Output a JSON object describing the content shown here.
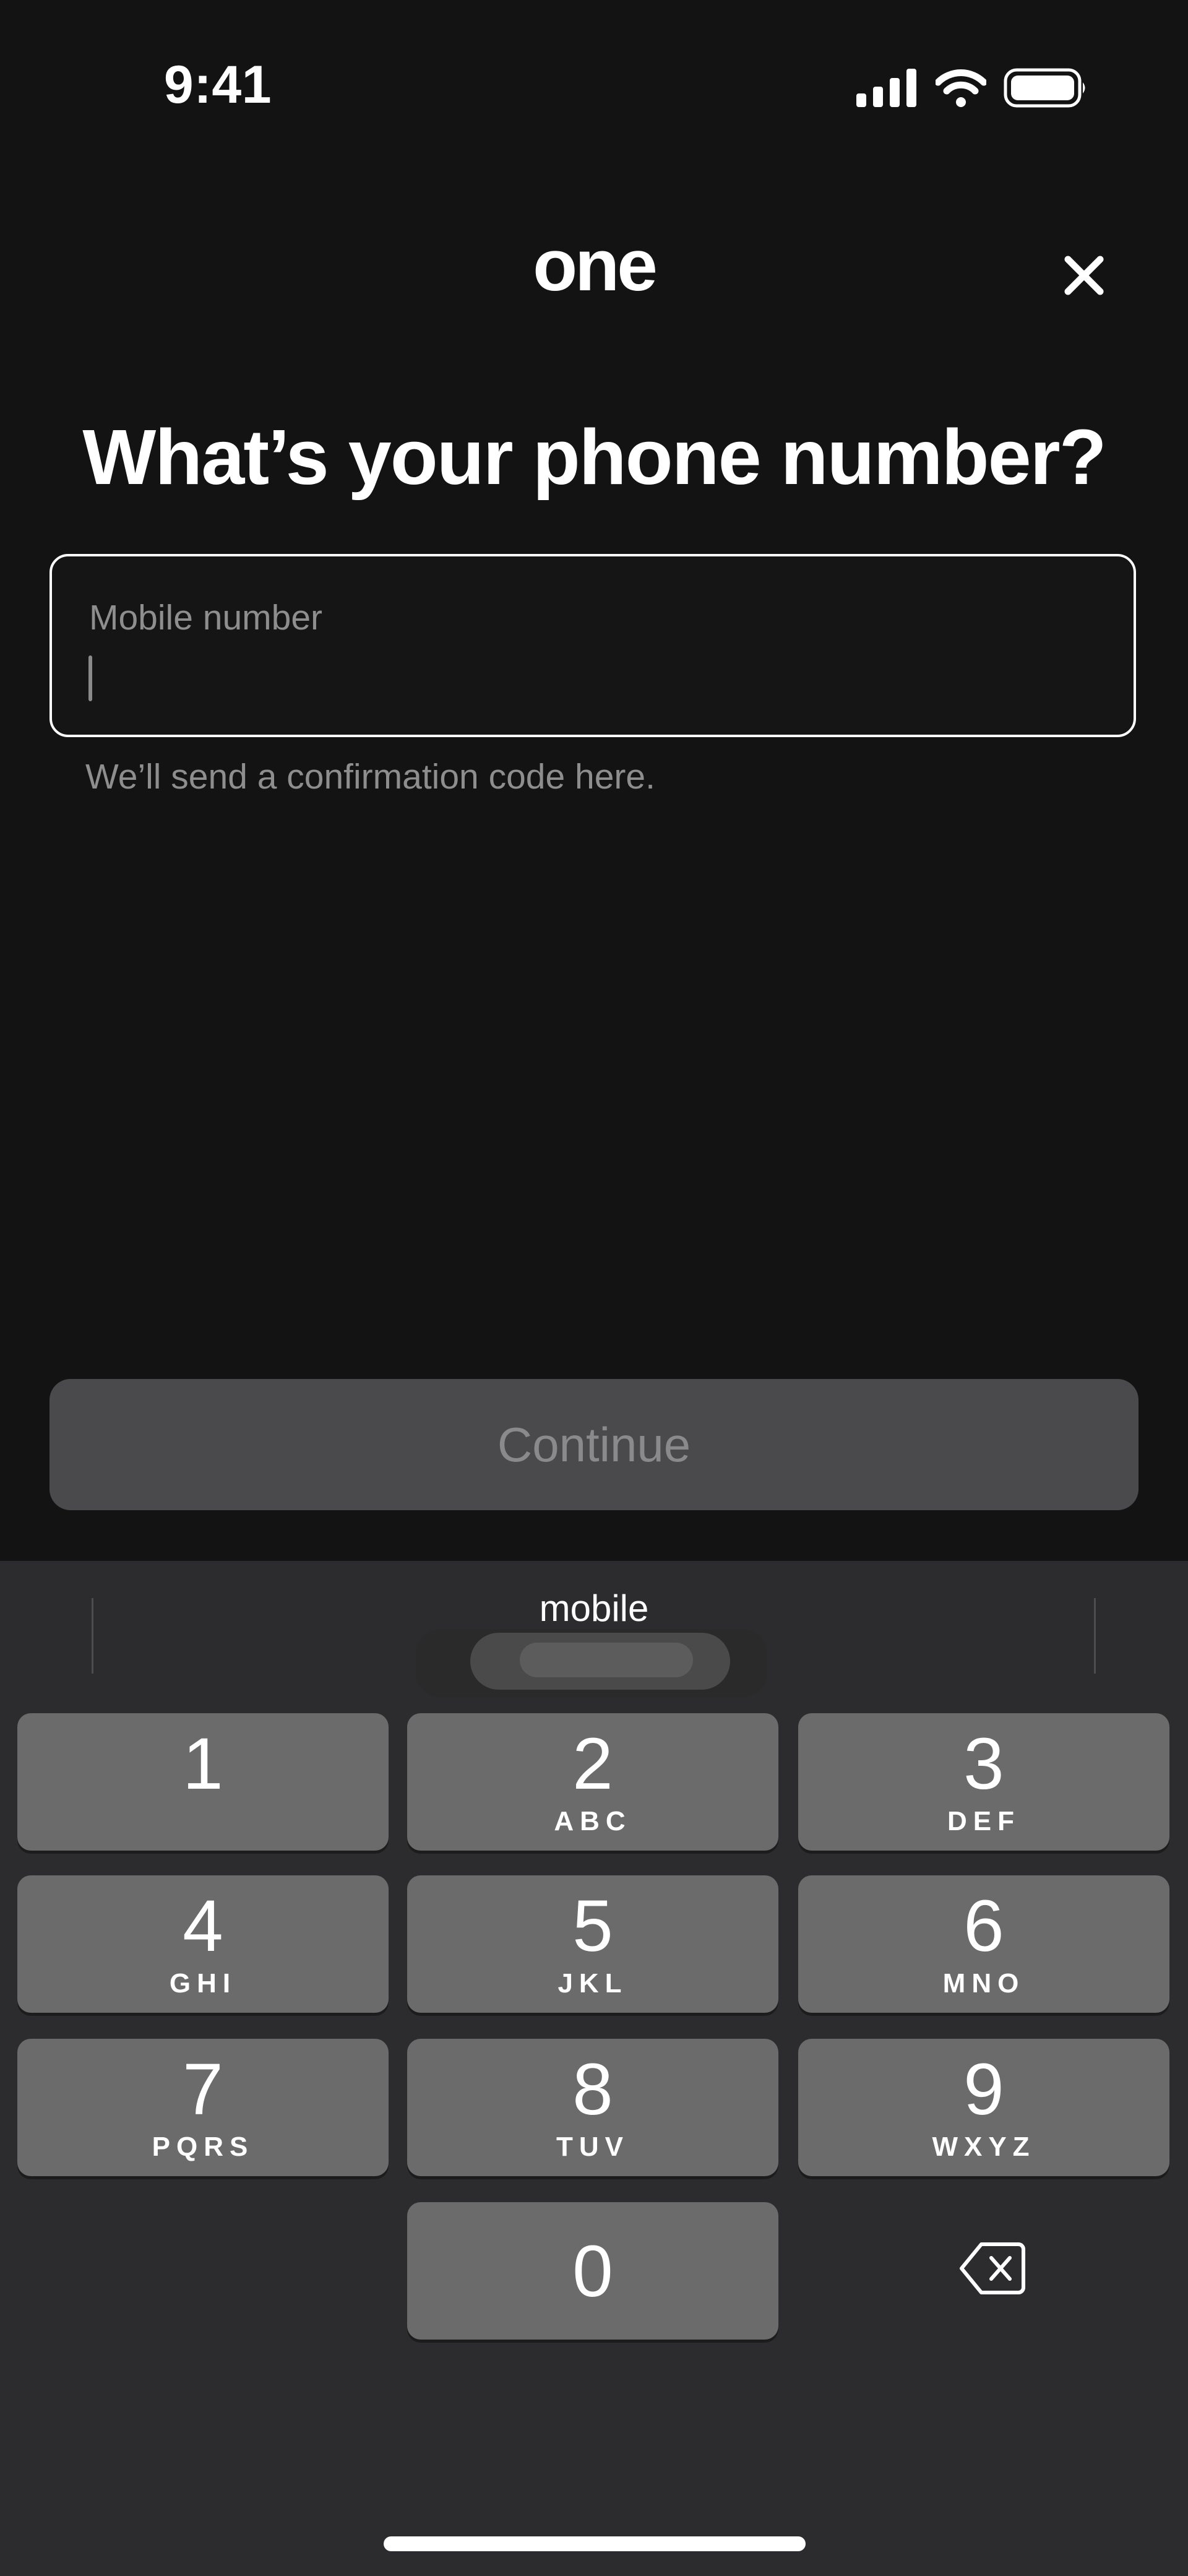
{
  "status_bar": {
    "time": "9:41",
    "signal_icon": "cellular-signal-icon",
    "wifi_icon": "wifi-icon",
    "battery_icon": "battery-icon"
  },
  "header": {
    "logo_text": "one",
    "close_icon": "close-icon"
  },
  "page": {
    "title": "What’s your phone number?"
  },
  "phone_field": {
    "label": "Mobile number",
    "value": "",
    "helper_text": "We’ll send a confirmation code here."
  },
  "continue_button": {
    "label": "Continue",
    "enabled": false
  },
  "keyboard": {
    "suggestion": "mobile",
    "keys": [
      {
        "digit": "1",
        "letters": ""
      },
      {
        "digit": "2",
        "letters": "ABC"
      },
      {
        "digit": "3",
        "letters": "DEF"
      },
      {
        "digit": "4",
        "letters": "GHI"
      },
      {
        "digit": "5",
        "letters": "JKL"
      },
      {
        "digit": "6",
        "letters": "MNO"
      },
      {
        "digit": "7",
        "letters": "PQRS"
      },
      {
        "digit": "8",
        "letters": "TUV"
      },
      {
        "digit": "9",
        "letters": "WXYZ"
      },
      {
        "digit": "0",
        "letters": ""
      }
    ],
    "delete_icon": "backspace-icon"
  },
  "colors": {
    "background": "#131313",
    "keyboard_background": "#2c2c2e",
    "key_background": "#6b6b6b",
    "button_disabled": "#4a4a4c"
  }
}
